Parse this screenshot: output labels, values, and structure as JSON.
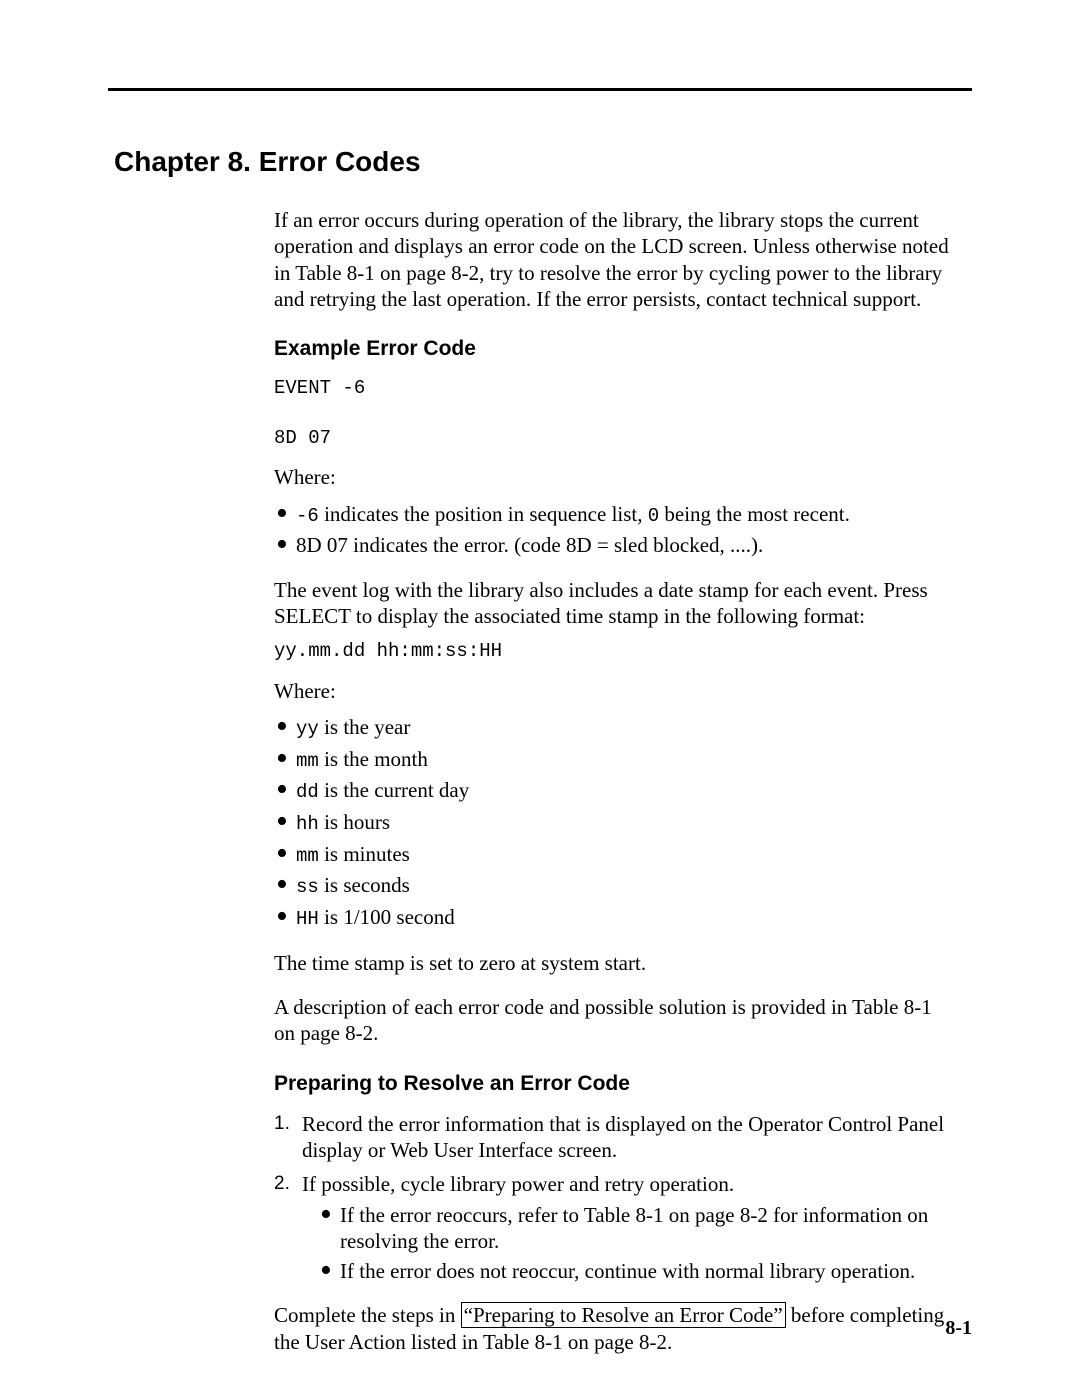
{
  "chapter_title": "Chapter 8. Error Codes",
  "intro_paragraph": "If an error occurs during operation of the library, the library stops the current operation and displays an error code on the LCD screen. Unless otherwise noted in Table 8-1 on page 8-2, try to resolve the error by cycling power to the library and retrying the last operation. If the error persists, contact technical support.",
  "section1": {
    "heading": "Example Error Code",
    "codeblock1_line1": "EVENT -6",
    "codeblock1_line2": "8D 07",
    "where_label": "Where:",
    "bullets1": {
      "item1_prefix": "-6",
      "item1_rest": " indicates the position in sequence list, ",
      "item1_code2": "0",
      "item1_tail": " being the most recent.",
      "item2": "8D 07 indicates the error. (code 8D = sled blocked, ....)."
    },
    "para_after_bullets1": "The event log with the library also includes a date stamp for each event. Press SELECT to display the associated time stamp in the following format:",
    "codeblock2": "yy.mm.dd hh:mm:ss:HH",
    "where_label2": "Where:",
    "bullets2": {
      "i1_code": "yy",
      "i1_rest": " is the year",
      "i2_code": "mm",
      "i2_rest": " is the month",
      "i3_code": "dd",
      "i3_rest": " is the current day",
      "i4_code": "hh",
      "i4_rest": " is hours",
      "i5_code": "mm",
      "i5_rest": " is minutes",
      "i6_code": "ss",
      "i6_rest": " is seconds",
      "i7_code": "HH",
      "i7_rest": " is 1/100 second"
    },
    "para_time_reset": "The time stamp is set to zero at system start.",
    "para_desc": "A description of each error code and possible solution is provided in Table 8-1 on page 8-2."
  },
  "section2": {
    "heading": "Preparing to Resolve an Error Code",
    "steps": {
      "s1": "Record the error information that is displayed on the Operator Control Panel display or Web User Interface screen.",
      "s2": "If possible, cycle library power and retry operation.",
      "s2_sub1": "If the error reoccurs, refer to Table 8-1 on page 8-2 for information on resolving the error.",
      "s2_sub2": "If the error does not reoccur, continue with normal library operation."
    },
    "closing_before": "Complete the steps in ",
    "closing_link": "“Preparing to Resolve an Error Code”",
    "closing_after": " before completing the User Action listed in Table 8-1 on page 8-2."
  },
  "page_number": "8-1"
}
